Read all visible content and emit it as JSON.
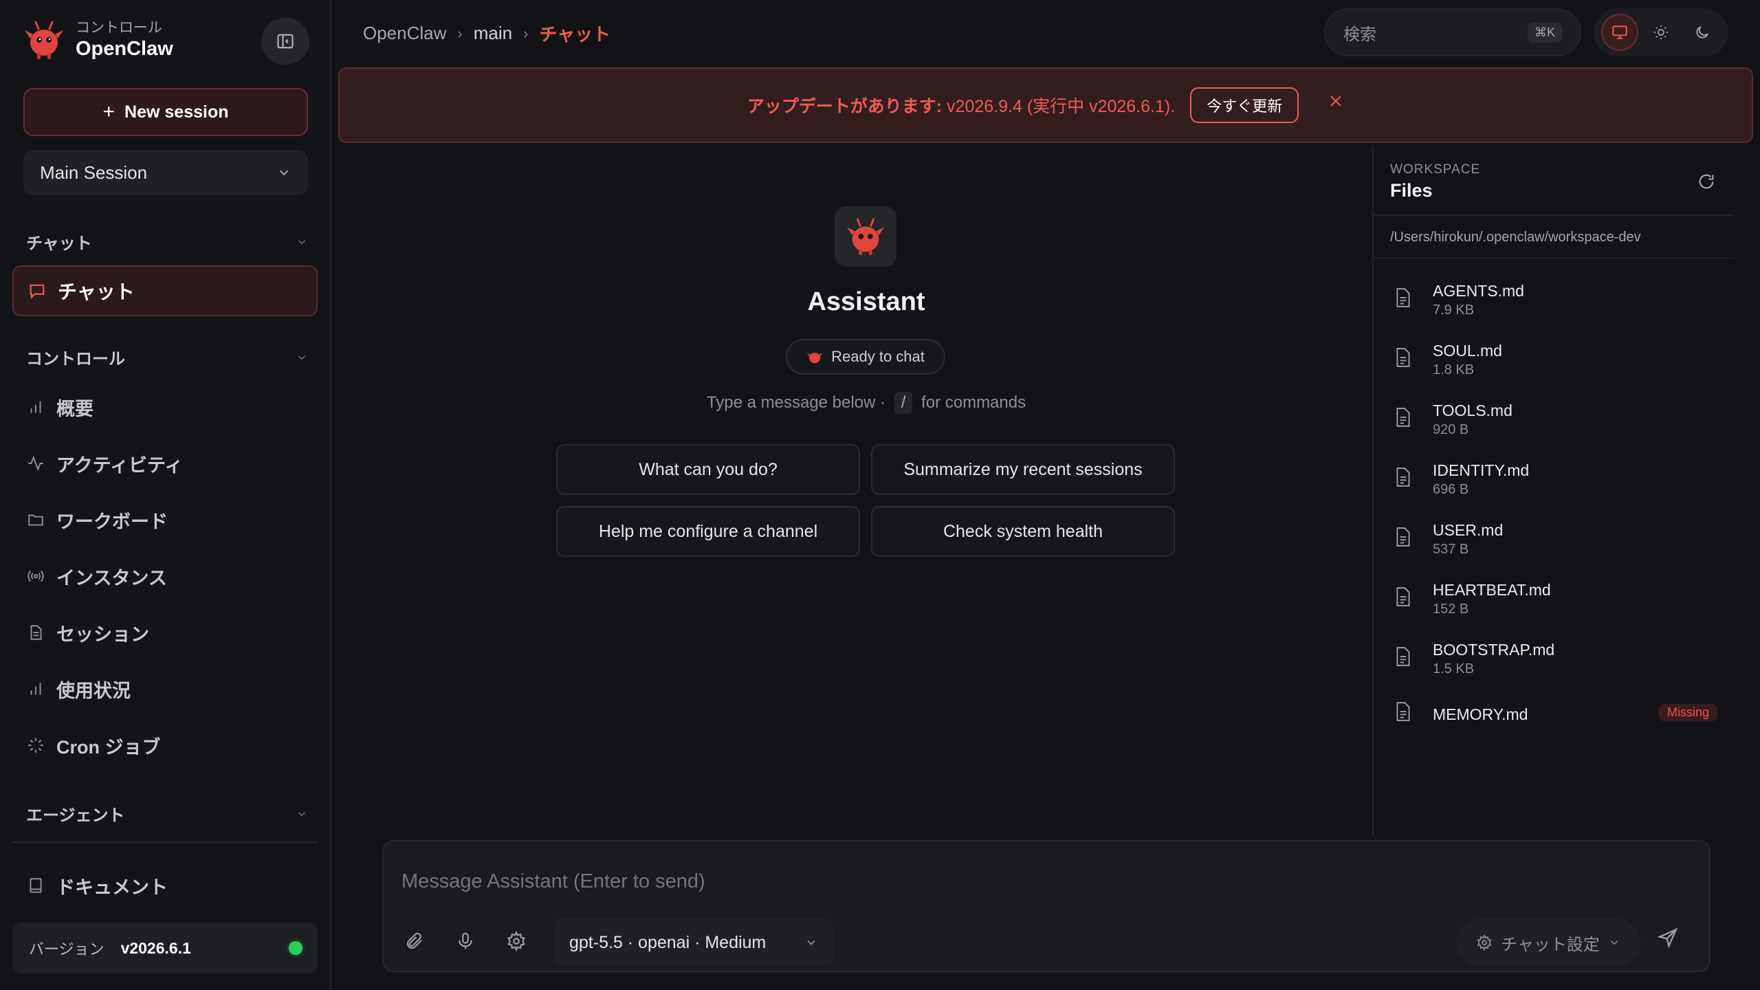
{
  "brand": {
    "subtitle": "コントロール",
    "title": "OpenClaw"
  },
  "sidebar": {
    "new_session_label": "New session",
    "session_select": "Main Session",
    "sections": {
      "chat": "チャット",
      "control": "コントロール",
      "agent": "エージェント"
    },
    "active_item": "チャット",
    "items": [
      {
        "label": "概要",
        "icon": "bar-chart-icon"
      },
      {
        "label": "アクティビティ",
        "icon": "activity-icon"
      },
      {
        "label": "ワークボード",
        "icon": "folder-icon"
      },
      {
        "label": "インスタンス",
        "icon": "broadcast-icon"
      },
      {
        "label": "セッション",
        "icon": "document-icon"
      },
      {
        "label": "使用状況",
        "icon": "bar-chart-icon"
      },
      {
        "label": "Cron ジョブ",
        "icon": "loader-icon"
      }
    ],
    "docs_label": "ドキュメント",
    "version_label": "バージョン",
    "version_value": "v2026.6.1"
  },
  "topbar": {
    "breadcrumb": [
      "OpenClaw",
      "main",
      "チャット"
    ],
    "search_placeholder": "検索",
    "search_shortcut": "⌘K"
  },
  "banner": {
    "prefix": "アップデートがあります:",
    "message": " v2026.9.4 (実行中 v2026.6.1).",
    "button": "今すぐ更新"
  },
  "chat": {
    "assistant_name": "Assistant",
    "status": "Ready to chat",
    "hint_before": "Type a message below ·",
    "hint_key": "/",
    "hint_after": "for commands",
    "suggestions": [
      "What can you do?",
      "Summarize my recent sessions",
      "Help me configure a channel",
      "Check system health"
    ]
  },
  "workspace": {
    "label": "WORKSPACE",
    "title": "Files",
    "path": "/Users/hirokun/.openclaw/workspace-dev",
    "files": [
      {
        "name": "AGENTS.md",
        "size": "7.9 KB"
      },
      {
        "name": "SOUL.md",
        "size": "1.8 KB"
      },
      {
        "name": "TOOLS.md",
        "size": "920 B"
      },
      {
        "name": "IDENTITY.md",
        "size": "696 B"
      },
      {
        "name": "USER.md",
        "size": "537 B"
      },
      {
        "name": "HEARTBEAT.md",
        "size": "152 B"
      },
      {
        "name": "BOOTSTRAP.md",
        "size": "1.5 KB"
      },
      {
        "name": "MEMORY.md",
        "size": "",
        "badge": "Missing"
      }
    ]
  },
  "composer": {
    "placeholder": "Message Assistant (Enter to send)",
    "model": "gpt-5.5 · openai · Medium",
    "chat_settings": "チャット設定"
  },
  "colors": {
    "accent": "#ef5b50",
    "background": "#121316",
    "online": "#2ecc5a"
  }
}
